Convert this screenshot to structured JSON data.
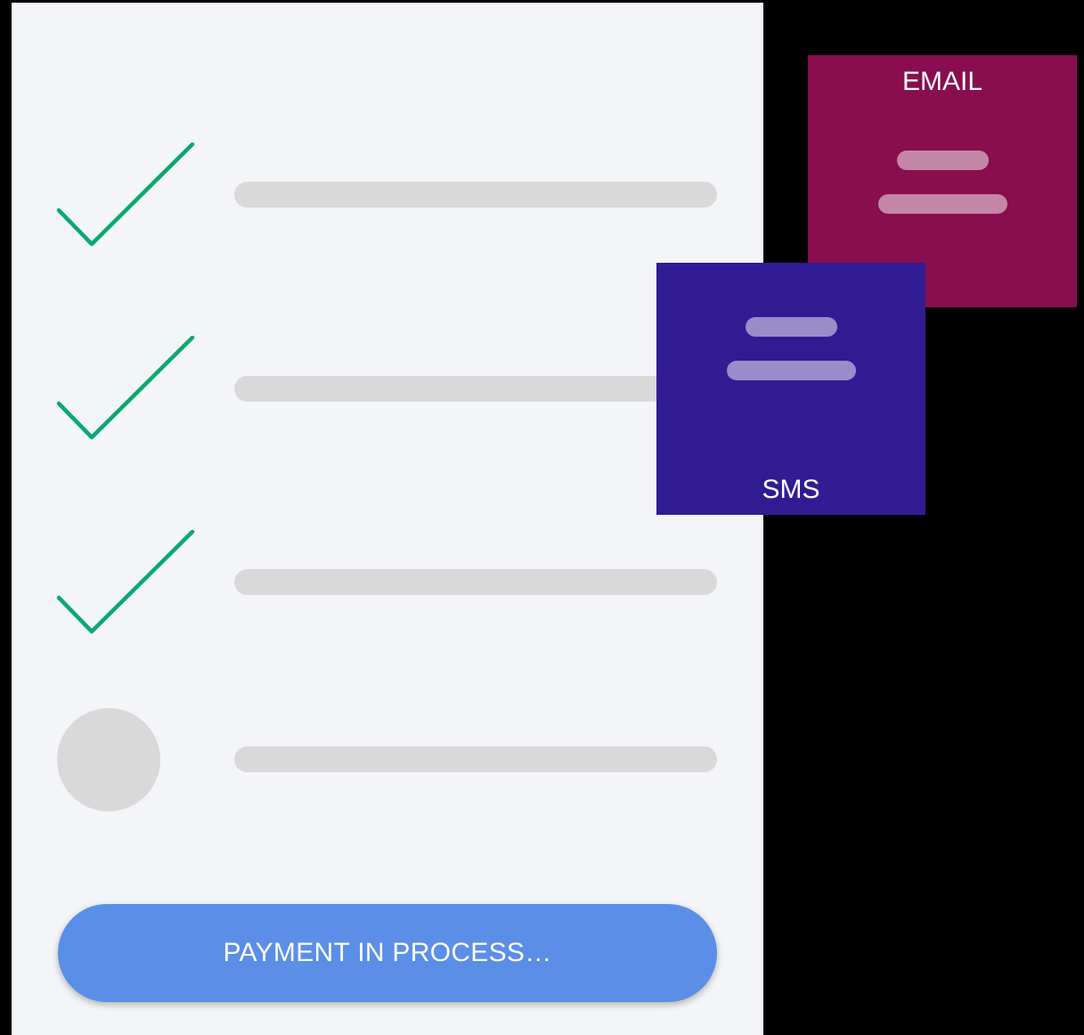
{
  "steps": [
    {
      "status": "completed",
      "icon": "check-icon"
    },
    {
      "status": "completed",
      "icon": "check-icon"
    },
    {
      "status": "completed",
      "icon": "check-icon"
    },
    {
      "status": "pending",
      "icon": "pending-circle"
    }
  ],
  "payment_button": {
    "label": "PAYMENT IN PROCESS…"
  },
  "notifications": {
    "email": {
      "label": "EMAIL",
      "color": "#880e4f"
    },
    "sms": {
      "label": "SMS",
      "color": "#311b92"
    }
  },
  "colors": {
    "check": "#0aa870",
    "placeholder": "#d9d9d9",
    "button": "#5b8ee6",
    "panel": "#f3f5f8"
  }
}
